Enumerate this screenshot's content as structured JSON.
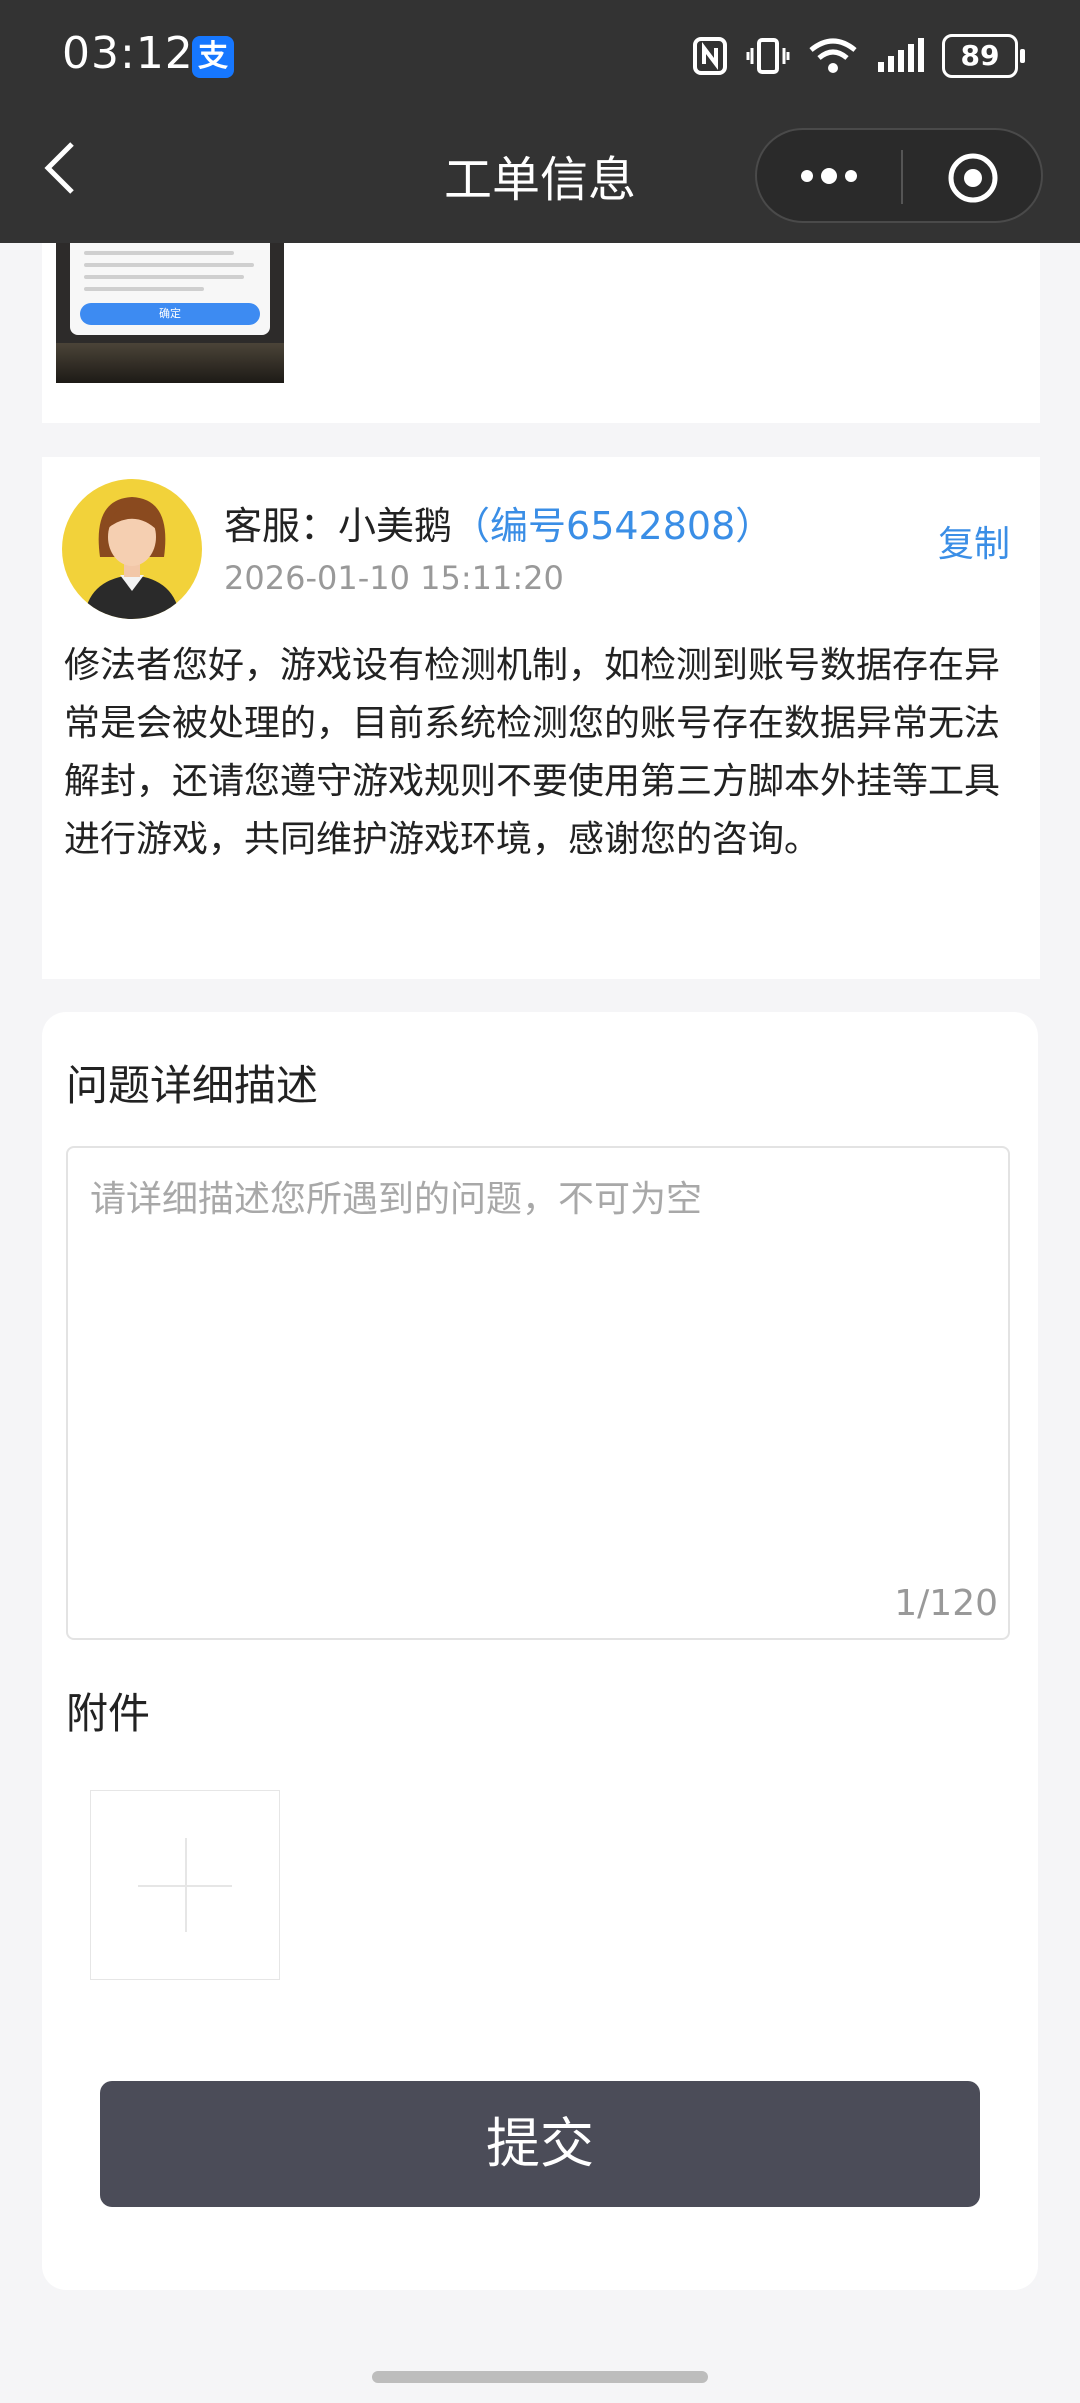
{
  "status_bar": {
    "time": "03:12",
    "app_badge": "支",
    "battery": "89"
  },
  "nav": {
    "title": "工单信息"
  },
  "thumbnail": {
    "button_label": "确定"
  },
  "reply": {
    "agent_prefix": "客服：小美鹅",
    "agent_id": "（编号6542808）",
    "time": "2026-01-10 15:11:20",
    "copy_label": "复制",
    "message": "修法者您好，游戏设有检测机制，如检测到账号数据存在异常是会被处理的，目前系统检测您的账号存在数据异常无法解封，还请您遵守游戏规则不要使用第三方脚本外挂等工具进行游戏，共同维护游戏环境，感谢您的咨询。"
  },
  "form": {
    "description_label": "问题详细描述",
    "description_placeholder": "请详细描述您所遇到的问题，不可为空",
    "char_count": "1/120",
    "attachment_label": "附件",
    "submit_label": "提交"
  },
  "colors": {
    "nav_bg": "#333333",
    "accent": "#3a8ee6",
    "submit_bg": "#4b4c58",
    "avatar_bg": "#f2d23a"
  }
}
